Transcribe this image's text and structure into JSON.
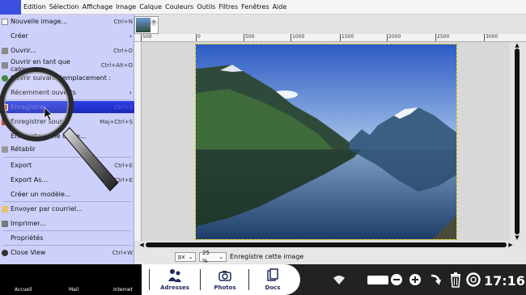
{
  "menubar": {
    "items": [
      "Edition",
      "Sélection",
      "Affichage",
      "Image",
      "Calque",
      "Couleurs",
      "Outils",
      "Filtres",
      "Fenêtres",
      "Aide"
    ]
  },
  "file_menu": {
    "items": [
      {
        "label": "Nouvelle image...",
        "shortcut": "Ctrl+N"
      },
      {
        "label": "Créer",
        "shortcut": ""
      },
      {
        "label": "Ouvrir...",
        "shortcut": "Ctrl+O"
      },
      {
        "label": "Ouvrir en tant que calques...",
        "shortcut": "Ctrl+Alt+O"
      },
      {
        "label": "Ouvrir suivant l'emplacement :",
        "shortcut": ""
      },
      {
        "label": "Récemment ouverts",
        "shortcut": ""
      },
      {
        "label": "Enregistrer",
        "shortcut": "Ctrl+S"
      },
      {
        "label": "Enregistrer sous...",
        "shortcut": "Maj+Ctrl+S"
      },
      {
        "label": "Enregistrer une copie...",
        "shortcut": ""
      },
      {
        "label": "Rétablir",
        "shortcut": ""
      },
      {
        "label": "Export",
        "shortcut": "Ctrl+E"
      },
      {
        "label": "Export As...",
        "shortcut": "Ctrl+E"
      },
      {
        "label": "Créer un modèle...",
        "shortcut": ""
      },
      {
        "label": "Envoyer par courriel...",
        "shortcut": ""
      },
      {
        "label": "Imprimer...",
        "shortcut": ""
      },
      {
        "label": "Propriétés",
        "shortcut": ""
      },
      {
        "label": "Close View",
        "shortcut": "Ctrl+W"
      }
    ]
  },
  "ruler": {
    "ticks": [
      "500",
      "0",
      "500",
      "1000",
      "1500",
      "2000",
      "2500",
      "3000"
    ]
  },
  "statusbar": {
    "unit": "px",
    "zoom": "25 %",
    "message": "Enregistre cette image"
  },
  "taskbar": {
    "left_labels": [
      "Accueil",
      "Mail",
      "Internet"
    ],
    "buttons": [
      "Adresses",
      "Photos",
      "Docs"
    ],
    "clock": "17:16"
  },
  "colors": {
    "menu_bg": "#cdd0fa",
    "highlight": "#2c3ee6",
    "taskbar": "#222222"
  }
}
